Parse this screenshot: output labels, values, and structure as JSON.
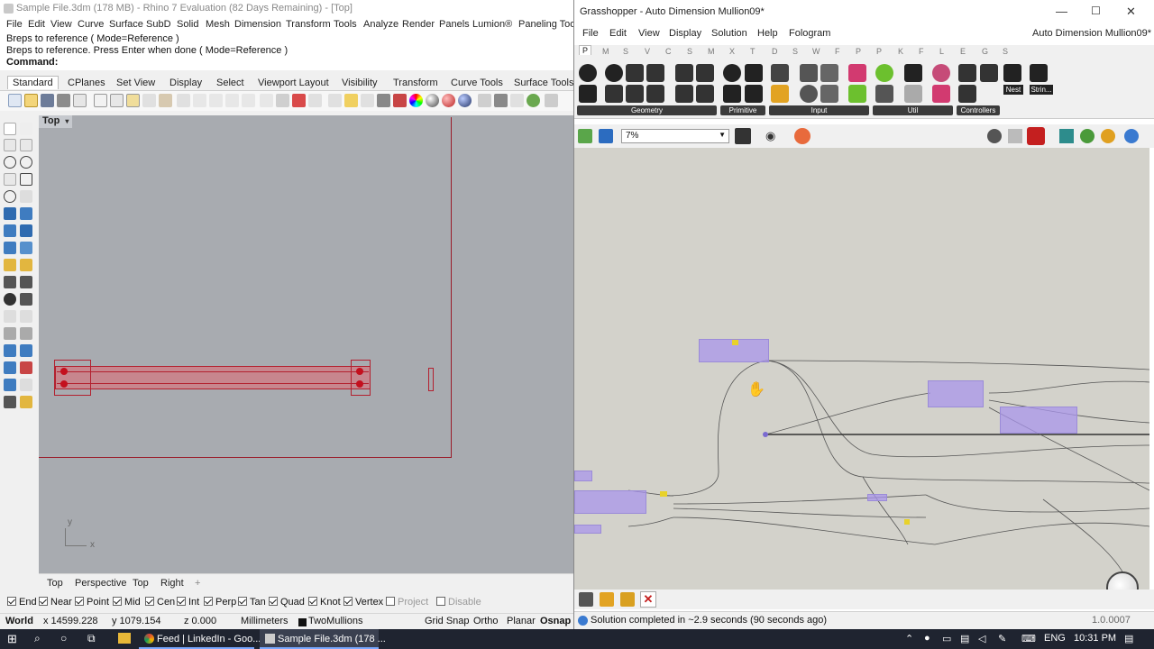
{
  "rhino": {
    "title": "Sample File.3dm (178 MB) - Rhino 7 Evaluation (82 Days Remaining) - [Top]",
    "menu": [
      "File",
      "Edit",
      "View",
      "Curve",
      "Surface",
      "SubD",
      "Solid",
      "Mesh",
      "Dimension",
      "Transform",
      "Tools",
      "Analyze",
      "Render",
      "Panels",
      "Lumion®",
      "Paneling Tools"
    ],
    "history": [
      "Breps to reference ( Mode=Reference )",
      "Breps to reference. Press Enter when done ( Mode=Reference )"
    ],
    "command_label": "Command:",
    "toolbar_tabs": [
      "Standard",
      "CPlanes",
      "Set View",
      "Display",
      "Select",
      "Viewport Layout",
      "Visibility",
      "Transform",
      "Curve Tools",
      "Surface Tools"
    ],
    "viewport_label": "Top",
    "viewport_tabs": [
      "Top",
      "Perspective",
      "Top",
      "Right"
    ],
    "osnaps": [
      {
        "label": "End",
        "checked": true
      },
      {
        "label": "Near",
        "checked": true
      },
      {
        "label": "Point",
        "checked": true
      },
      {
        "label": "Mid",
        "checked": true
      },
      {
        "label": "Cen",
        "checked": true
      },
      {
        "label": "Int",
        "checked": true
      },
      {
        "label": "Perp",
        "checked": true
      },
      {
        "label": "Tan",
        "checked": true
      },
      {
        "label": "Quad",
        "checked": true
      },
      {
        "label": "Knot",
        "checked": true
      },
      {
        "label": "Vertex",
        "checked": true
      },
      {
        "label": "Project",
        "checked": false
      },
      {
        "label": "Disable",
        "checked": false
      }
    ],
    "status": {
      "cplane": "World",
      "x": "x 14599.228",
      "y": "y 1079.154",
      "z": "z 0.000",
      "units": "Millimeters",
      "layer": "TwoMullions",
      "grid_snap": "Grid Snap",
      "ortho": "Ortho",
      "planar": "Planar",
      "osnap": "Osnap"
    },
    "axis_x": "x",
    "axis_y": "y"
  },
  "grasshopper": {
    "title": "Grasshopper - Auto Dimension Mullion09*",
    "doc_name": "Auto Dimension Mullion09*",
    "menu": [
      "File",
      "Edit",
      "View",
      "Display",
      "Solution",
      "Help",
      "Fologram"
    ],
    "category_tabs": [
      "P",
      "M",
      "S",
      "V",
      "C",
      "S",
      "M",
      "X",
      "T",
      "D",
      "S",
      "W",
      "F",
      "P",
      "P",
      "K",
      "F",
      "L",
      "E",
      "G",
      "S"
    ],
    "groups": [
      "Geometry",
      "Primitive",
      "Input",
      "Util",
      "Controllers"
    ],
    "extra_icons": [
      "Nest",
      "Strin..."
    ],
    "zoom": "7%",
    "status": "Solution completed in ~2.9 seconds (90 seconds ago)",
    "version": "1.0.0007"
  },
  "taskbar": {
    "apps": [
      "Feed | LinkedIn - Goo...",
      "Sample File.3dm (178 ..."
    ],
    "lang": "ENG",
    "time": "10:31 PM"
  },
  "colors": {
    "viewport_bg": "#a8abb0",
    "mullion": "#d86e78",
    "gh_canvas": "#d3d2cb",
    "gh_component": "#aa96eb"
  }
}
